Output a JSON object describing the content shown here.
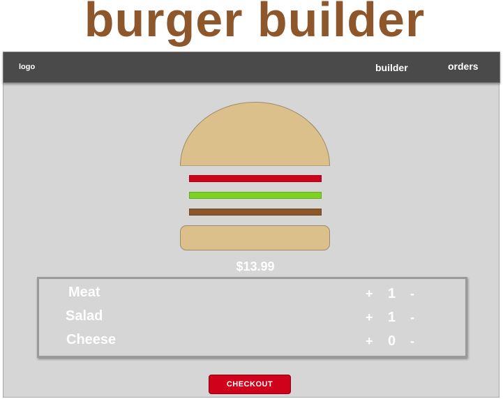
{
  "app": {
    "title": "burger builder"
  },
  "navbar": {
    "logo": "logo",
    "links": [
      {
        "label": "builder"
      },
      {
        "label": "orders"
      }
    ]
  },
  "burger": {
    "layers": [
      {
        "name": "meat",
        "color": "#d0021b"
      },
      {
        "name": "salad",
        "color": "#7ed321"
      },
      {
        "name": "cheese",
        "color": "#8b572a"
      }
    ],
    "bun_color": "#dcc08c"
  },
  "price": "$13.99",
  "ingredients": [
    {
      "label": "Meat",
      "plus": "+",
      "quantity": "1",
      "minus": "-"
    },
    {
      "label": "Salad",
      "plus": "+",
      "quantity": "1",
      "minus": "-"
    },
    {
      "label": "Cheese",
      "plus": "+",
      "quantity": "0",
      "minus": "-"
    }
  ],
  "checkout": {
    "label": "CHECKOUT",
    "color": "#d0021b"
  },
  "colors": {
    "title": "#8e562b",
    "navbar": "#4a4a4a",
    "background": "#d6d6d6"
  }
}
